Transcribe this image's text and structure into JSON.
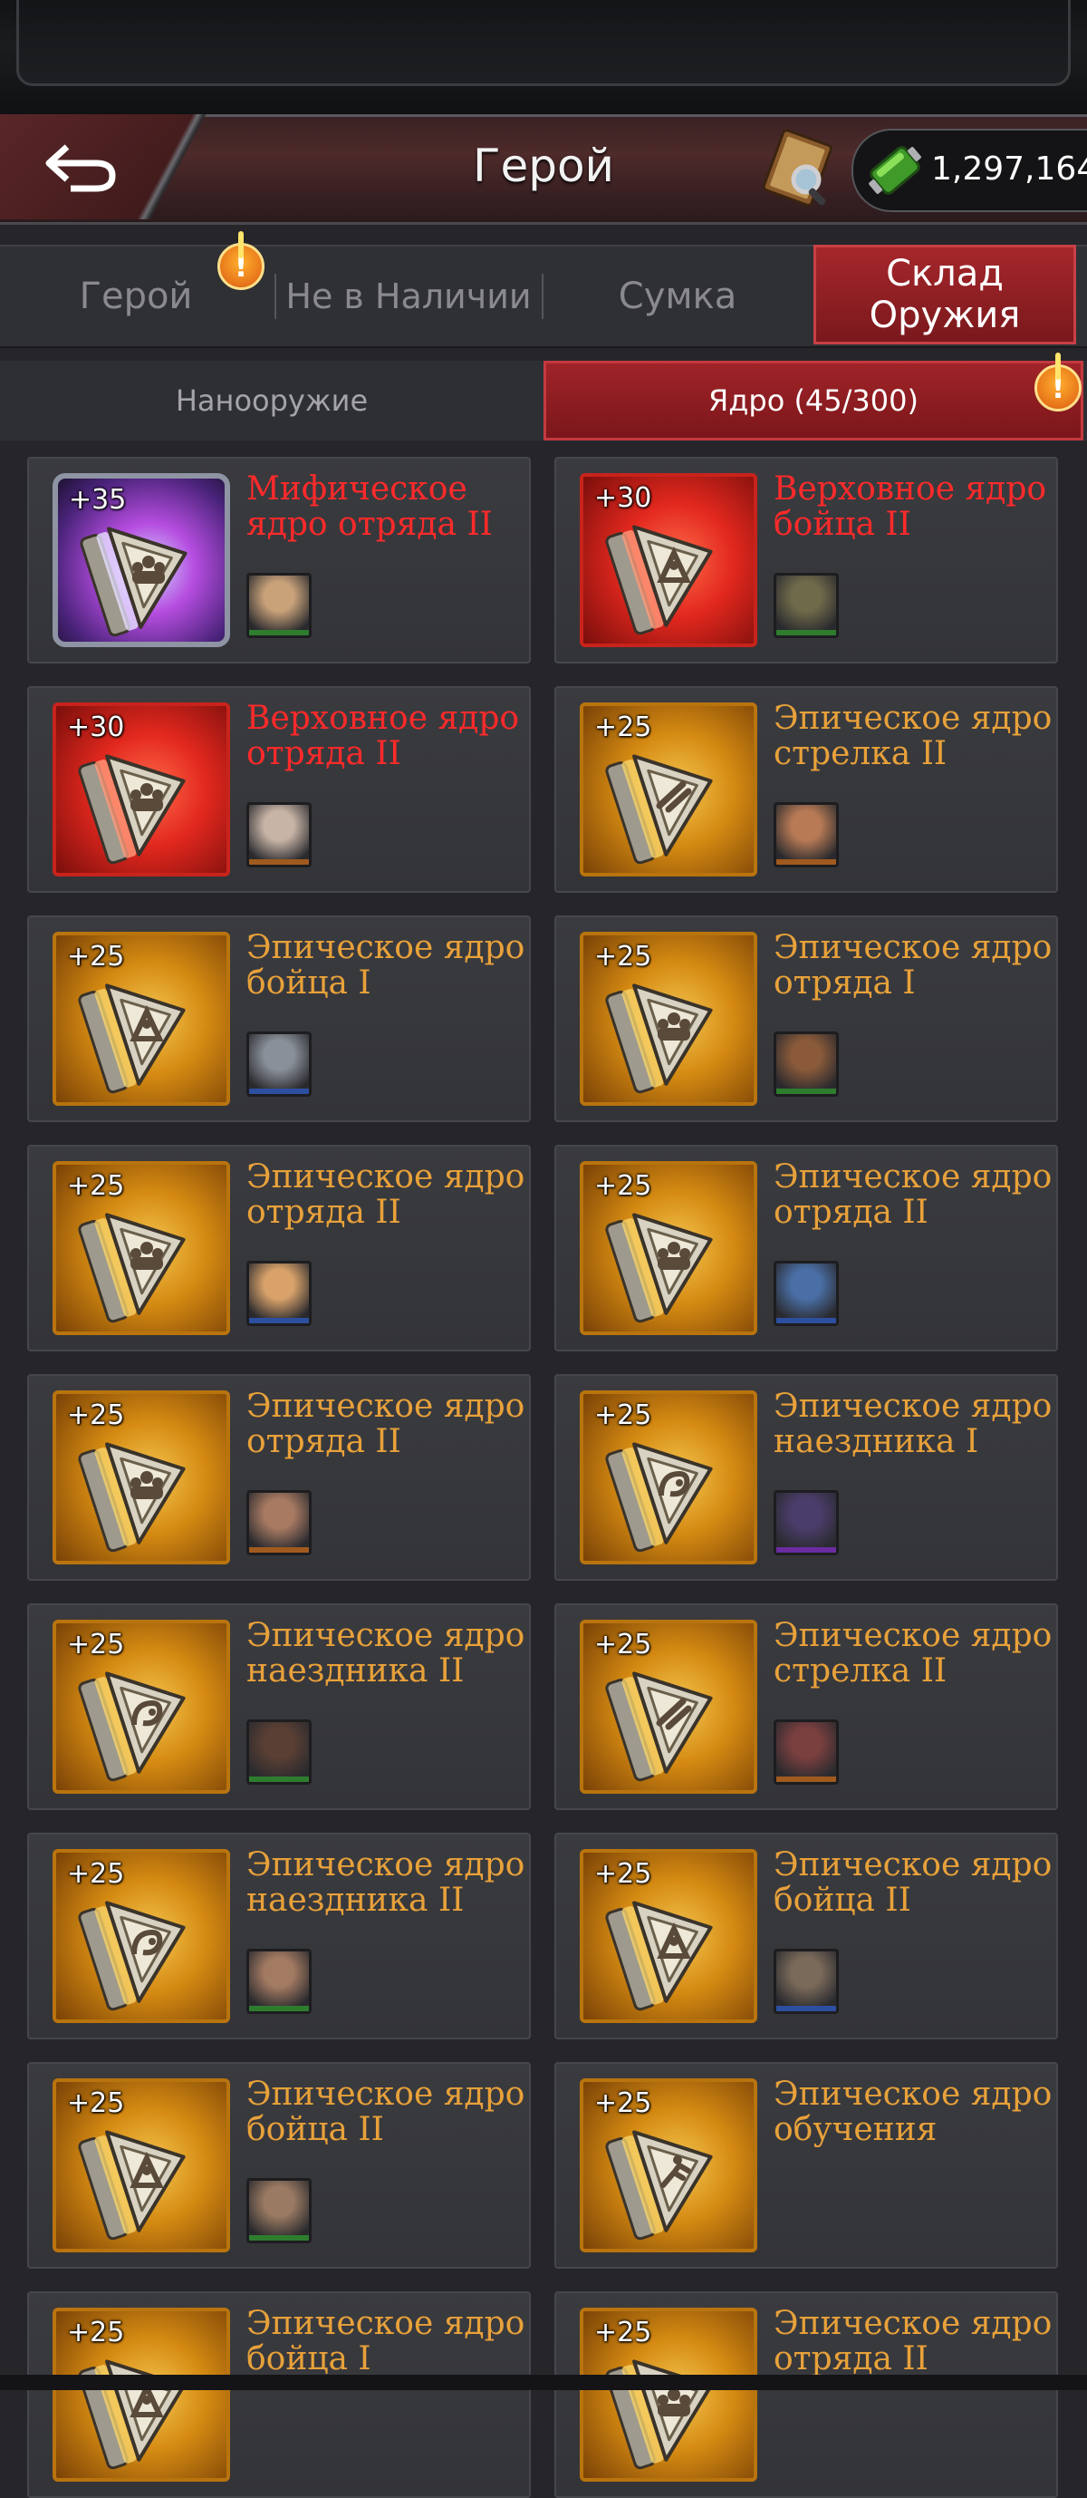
{
  "header": {
    "title": "Герой",
    "currency_value": "1,297,164",
    "currency_icon": "energy-cell-icon",
    "back_icon": "back-arrow-icon",
    "book_icon": "journal-magnifier-icon"
  },
  "tabs": [
    {
      "label": "Герой",
      "alert": "!"
    },
    {
      "label": "Не в Наличии"
    },
    {
      "label": "Сумка"
    },
    {
      "label": "Склад Оружия"
    }
  ],
  "subtabs": [
    {
      "label": "Нанооружие"
    },
    {
      "label": "Ядро (45/300)",
      "alert": "!"
    }
  ],
  "colors": {
    "epic": "#e8a13a",
    "supreme": "#ff2a2a",
    "active_tab": "#a5272b"
  },
  "items": [
    {
      "level": "+35",
      "name": "Мифическое ядро отряда II",
      "rarity": "mythic",
      "glyph": "squad",
      "hero_color": "#c9a27a",
      "band": "#2e7d2e"
    },
    {
      "level": "+30",
      "name": "Верховное ядро бойца II",
      "rarity": "supreme",
      "glyph": "fighter",
      "hero_color": "#6f6a4a",
      "band": "#2e7d2e"
    },
    {
      "level": "+30",
      "name": "Верховное ядро отряда II",
      "rarity": "supreme",
      "glyph": "squad",
      "hero_color": "#c8b4a6",
      "band": "#a05a1e"
    },
    {
      "level": "+25",
      "name": "Эпическое ядро стрелка II",
      "rarity": "epic",
      "glyph": "shooter",
      "hero_color": "#b77a55",
      "band": "#a05a1e"
    },
    {
      "level": "+25",
      "name": "Эпическое ядро бойца I",
      "rarity": "epic",
      "glyph": "fighter",
      "hero_color": "#8a909a",
      "band": "#2c4fa0"
    },
    {
      "level": "+25",
      "name": "Эпическое ядро отряда I",
      "rarity": "epic",
      "glyph": "squad",
      "hero_color": "#8a5a3a",
      "band": "#2e7d2e"
    },
    {
      "level": "+25",
      "name": "Эпическое ядро отряда II",
      "rarity": "epic",
      "glyph": "squad",
      "hero_color": "#d9a26a",
      "band": "#2c4fa0"
    },
    {
      "level": "+25",
      "name": "Эпическое ядро отряда II",
      "rarity": "epic",
      "glyph": "squad",
      "hero_color": "#4a6fa6",
      "band": "#2c4fa0"
    },
    {
      "level": "+25",
      "name": "Эпическое ядро отряда II",
      "rarity": "epic",
      "glyph": "squad",
      "hero_color": "#a87a62",
      "band": "#a05a1e"
    },
    {
      "level": "+25",
      "name": "Эпическое ядро наездника I",
      "rarity": "epic",
      "glyph": "rider",
      "hero_color": "#4b3d6b",
      "band": "#6a2ca0"
    },
    {
      "level": "+25",
      "name": "Эпическое ядро наездника II",
      "rarity": "epic",
      "glyph": "rider",
      "hero_color": "#5a3f34",
      "band": "#2e7d2e"
    },
    {
      "level": "+25",
      "name": "Эпическое ядро стрелка II",
      "rarity": "epic",
      "glyph": "shooter",
      "hero_color": "#7a3f3f",
      "band": "#a05a1e"
    },
    {
      "level": "+25",
      "name": "Эпическое ядро наездника II",
      "rarity": "epic",
      "glyph": "rider",
      "hero_color": "#a37a62",
      "band": "#2e7d2e"
    },
    {
      "level": "+25",
      "name": "Эпическое ядро бойца II",
      "rarity": "epic",
      "glyph": "fighter",
      "hero_color": "#7a6a5a",
      "band": "#2c4fa0"
    },
    {
      "level": "+25",
      "name": "Эпическое ядро бойца II",
      "rarity": "epic",
      "glyph": "fighter",
      "hero_color": "#9a7a62",
      "band": "#2e7d2e"
    },
    {
      "level": "+25",
      "name": "Эпическое ядро обучения",
      "rarity": "epic",
      "glyph": "training",
      "hero_color": "",
      "band": ""
    },
    {
      "level": "+25",
      "name": "Эпическое ядро бойца I",
      "rarity": "epic",
      "glyph": "fighter",
      "hero_color": "",
      "band": ""
    },
    {
      "level": "+25",
      "name": "Эпическое ядро отряда II",
      "rarity": "epic",
      "glyph": "squad",
      "hero_color": "",
      "band": ""
    }
  ]
}
